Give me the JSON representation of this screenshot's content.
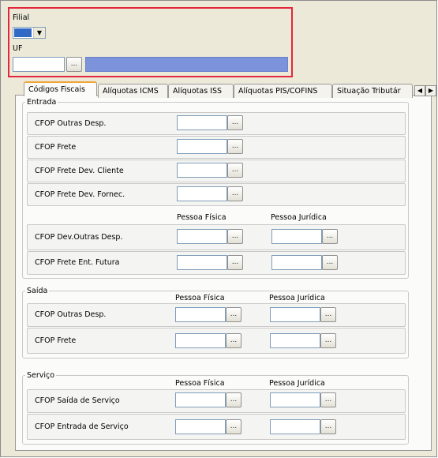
{
  "header": {
    "filial_label": "Filial",
    "uf_label": "UF",
    "uf_value": "",
    "dots": "...",
    "combo_arrow": "▼"
  },
  "tabs": [
    {
      "label": "Códigos Fiscais",
      "active": true
    },
    {
      "label": "Alíquotas ICMS"
    },
    {
      "label": "Alíquotas ISS"
    },
    {
      "label": "Alíquotas PIS/COFINS"
    },
    {
      "label": "Situação Tributár"
    }
  ],
  "tab_arrows": {
    "left": "◀",
    "right": "▶"
  },
  "entrada": {
    "title": "Entrada",
    "rows": [
      {
        "label": "CFOP Outras Desp."
      },
      {
        "label": "CFOP Frete"
      },
      {
        "label": "CFOP Frete Dev. Cliente"
      },
      {
        "label": "CFOP Frete Dev. Fornec."
      }
    ],
    "col_pf": "Pessoa Física",
    "col_pj": "Pessoa Jurídica",
    "rows2": [
      {
        "label": "CFOP Dev.Outras Desp."
      },
      {
        "label": "CFOP Frete Ent. Futura"
      }
    ]
  },
  "saida": {
    "title": "Saída",
    "col_pf": "Pessoa Física",
    "col_pj": "Pessoa Jurídica",
    "rows": [
      {
        "label": "CFOP Outras Desp."
      },
      {
        "label": "CFOP Frete"
      }
    ]
  },
  "servico": {
    "title": "Serviço",
    "col_pf": "Pessoa Física",
    "col_pj": "Pessoa Jurídica",
    "rows": [
      {
        "label": "CFOP Saída de Serviço"
      },
      {
        "label": "CFOP Entrada de Serviço"
      }
    ]
  },
  "colors": {
    "highlight": "#e3263b",
    "accent_bar": "#7c93dc",
    "tab_active_top": "#f0a43a"
  }
}
